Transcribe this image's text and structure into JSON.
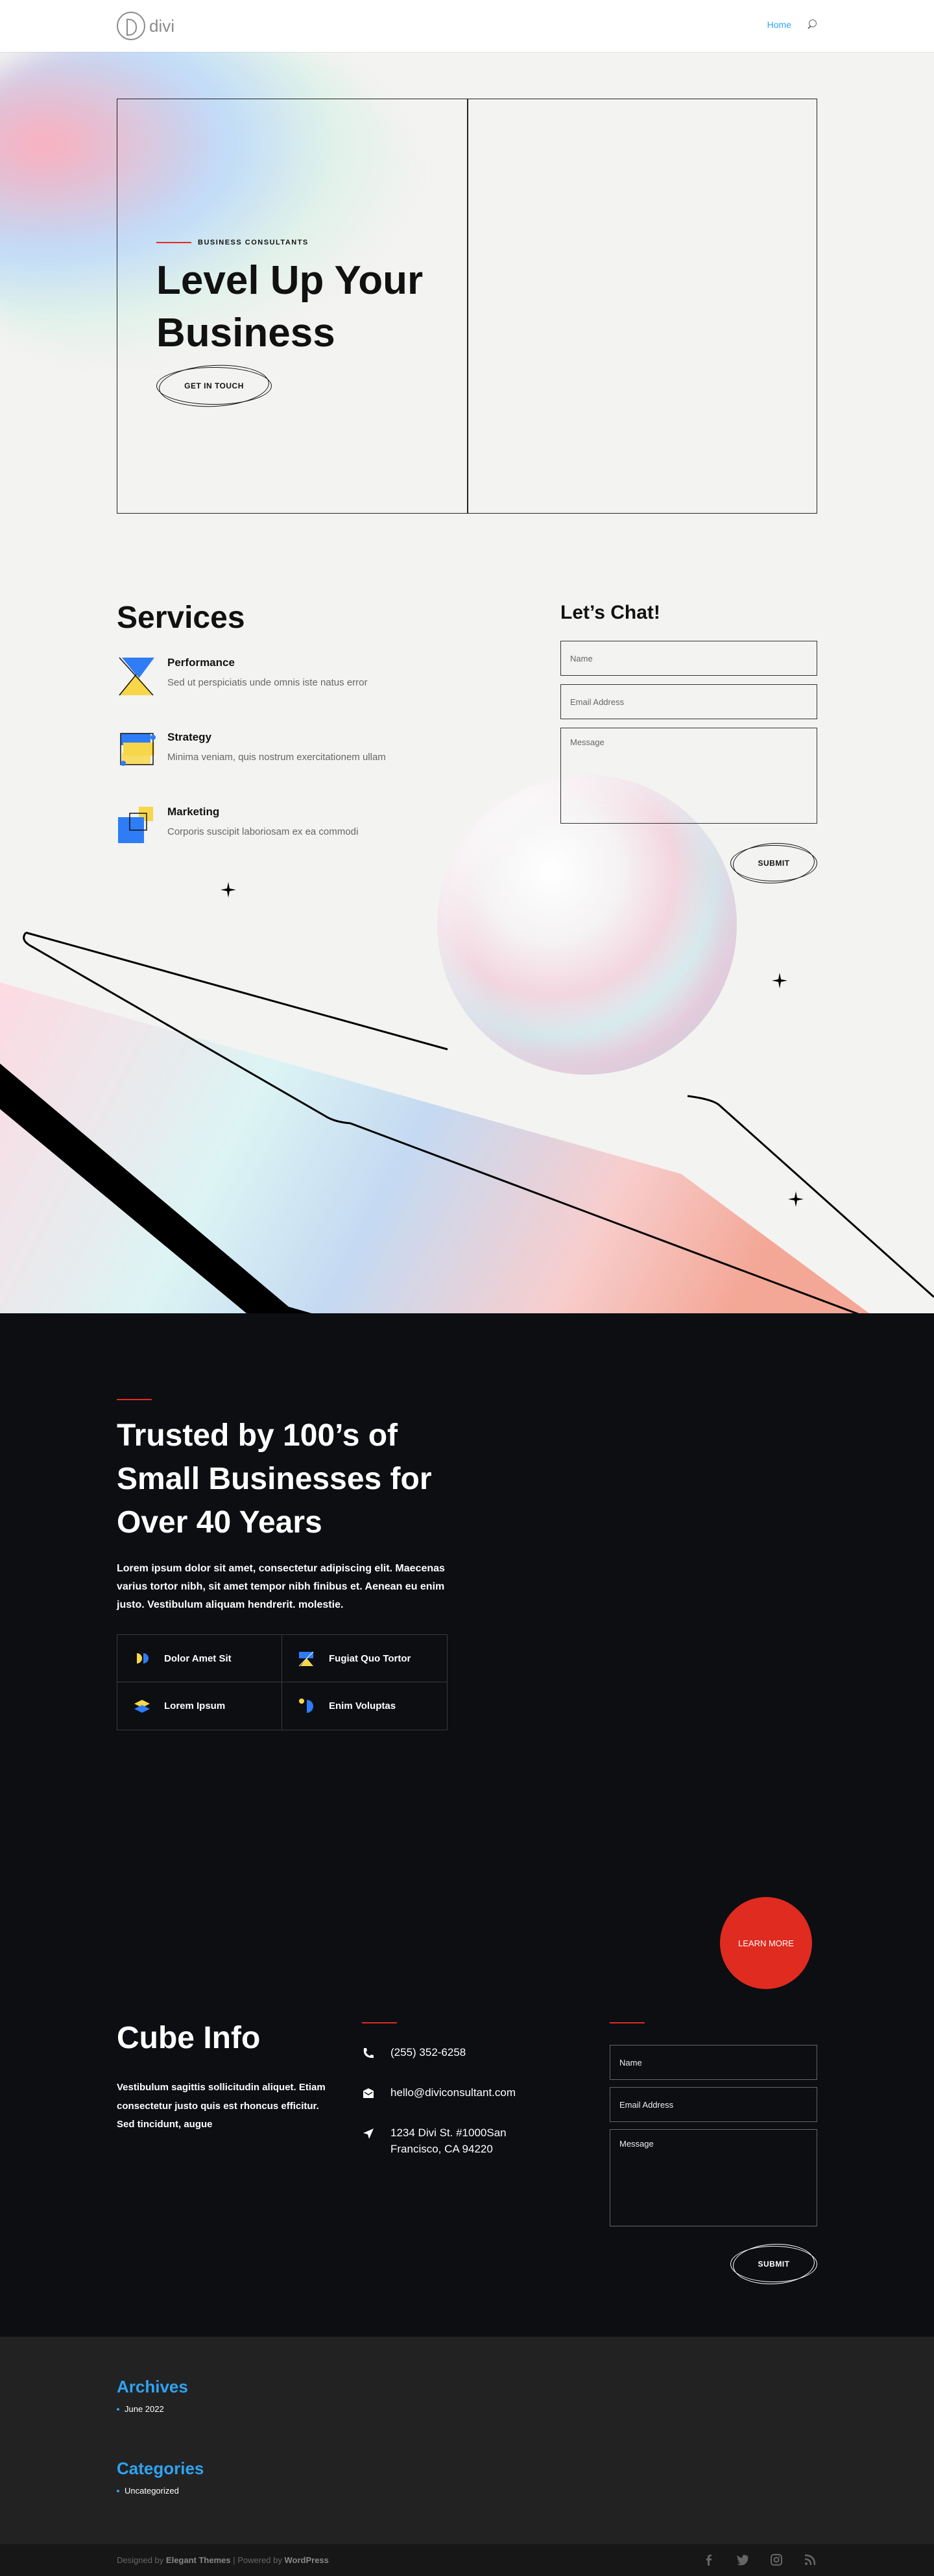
{
  "header": {
    "logo_text": "divi",
    "nav_home": "Home"
  },
  "hero": {
    "eyebrow": "BUSINESS CONSULTANTS",
    "title": "Level Up Your Business",
    "button": "GET IN TOUCH"
  },
  "services": {
    "title": "Services",
    "items": [
      {
        "name": "Performance",
        "desc": "Sed ut perspiciatis unde omnis iste natus error"
      },
      {
        "name": "Strategy",
        "desc": "Minima veniam, quis nostrum exercitationem ullam"
      },
      {
        "name": "Marketing",
        "desc": "Corporis suscipit laboriosam ex ea commodi"
      }
    ]
  },
  "chat": {
    "title": "Let’s Chat!",
    "name_placeholder": "Name",
    "email_placeholder": "Email Address",
    "message_placeholder": "Message",
    "submit": "SUBMIT"
  },
  "trust": {
    "title": "Trusted by 100’s of Small Businesses for Over 40 Years",
    "text": "Lorem ipsum dolor sit amet, consectetur adipiscing elit. Maecenas varius tortor nibh, sit amet tempor nibh finibus et. Aenean eu enim justo. Vestibulum aliquam hendrerit. molestie.",
    "features": [
      "Dolor Amet Sit",
      "Fugiat Quo Tortor",
      "Lorem Ipsum",
      "Enim Voluptas"
    ]
  },
  "learn_more": "LEARN MORE",
  "cube": {
    "title": "Cube Info",
    "text": "Vestibulum sagittis sollicitudin aliquet. Etiam consectetur justo quis est rhoncus efficitur. Sed tincidunt, augue",
    "phone": "(255) 352-6258",
    "email": "hello@diviconsultant.com",
    "address": "1234 Divi St. #1000San Francisco, CA 94220",
    "name_placeholder": "Name",
    "email_placeholder": "Email Address",
    "message_placeholder": "Message",
    "submit": "SUBMIT"
  },
  "widgets": {
    "archives_title": "Archives",
    "archives_item": "June 2022",
    "categories_title": "Categories",
    "categories_item": "Uncategorized"
  },
  "footer": {
    "designed_by": "Designed by",
    "elegant": "Elegant Themes",
    "powered": "| Powered by",
    "wordpress": "WordPress"
  },
  "icons": {
    "socials": [
      "facebook-icon",
      "twitter-icon",
      "instagram-icon",
      "rss-icon"
    ]
  },
  "colors": {
    "accent": "#2ea3f2",
    "red": "#e02b20",
    "dark_bg": "#0c0e12"
  }
}
